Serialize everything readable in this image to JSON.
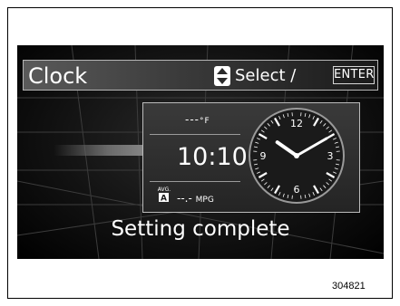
{
  "header": {
    "title": "Clock",
    "select_label": "Select /",
    "enter_label": "ENTER",
    "select_icon": "up-down-arrows-icon"
  },
  "info": {
    "temperature_value": "---",
    "temperature_unit": "°F",
    "time": "10:10",
    "mpg_badge_top": "AVG.",
    "mpg_badge_letter": "A",
    "mpg_value": "--.-",
    "mpg_unit": "MPG"
  },
  "analog_clock": {
    "hour": 10,
    "minute": 10,
    "numerals": [
      "12",
      "3",
      "6",
      "9"
    ]
  },
  "status_message": "Setting complete",
  "figure_code": "304821",
  "colors": {
    "screen_bg": "#121212",
    "text": "#ffffff",
    "border": "#bcbcbc"
  }
}
